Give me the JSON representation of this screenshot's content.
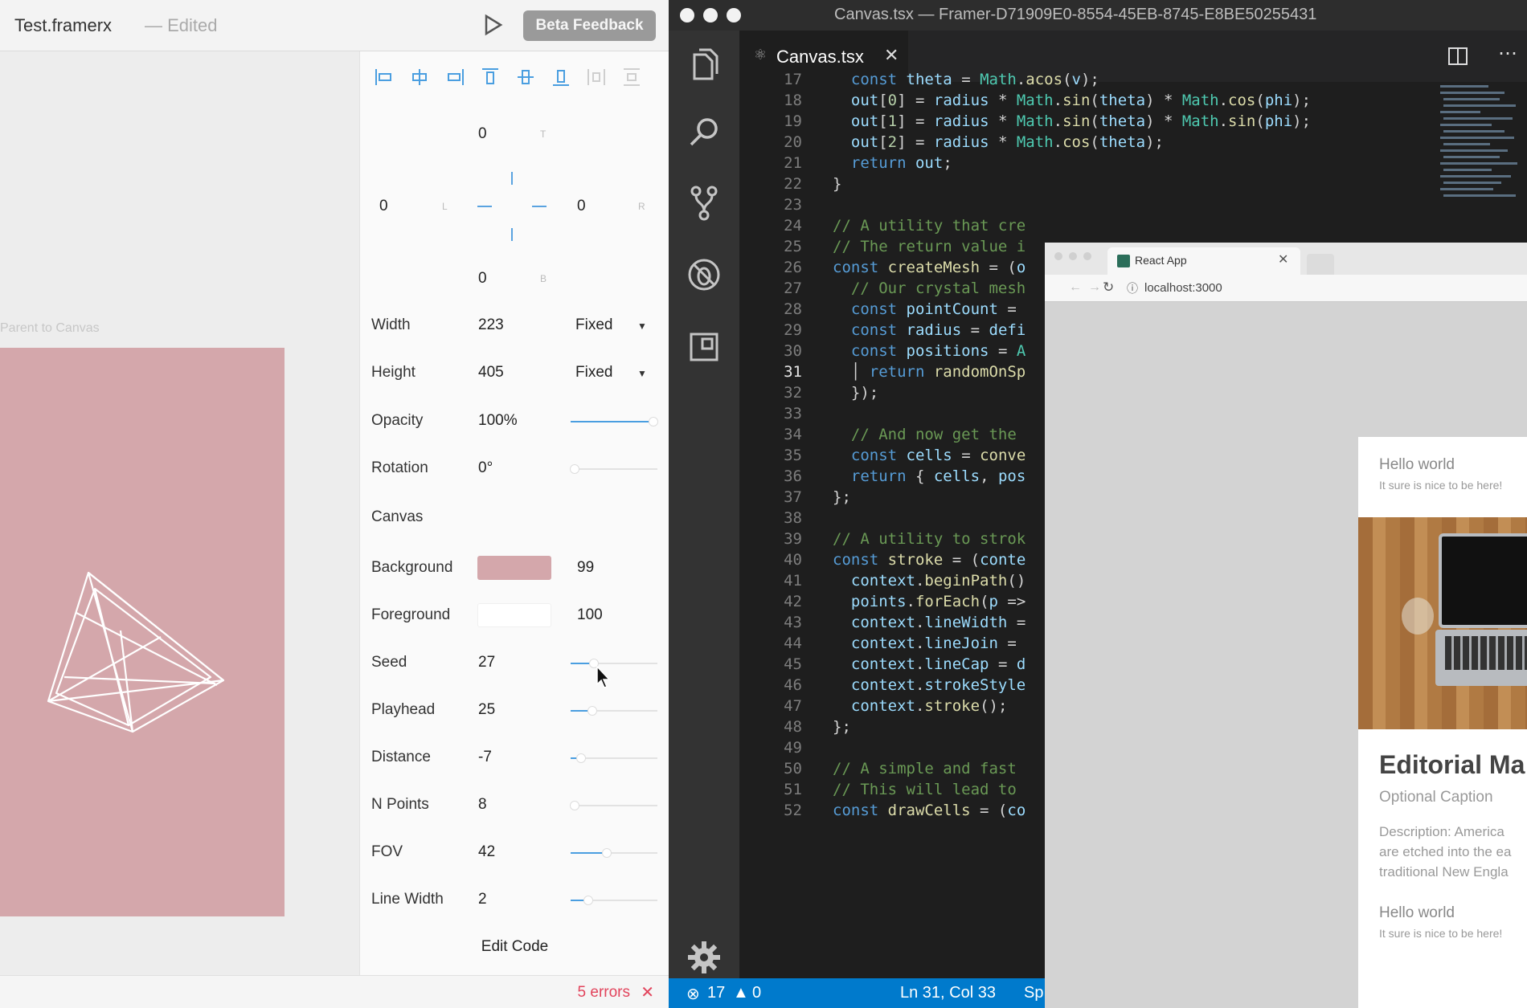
{
  "framer": {
    "title": "Test.framerx",
    "edited": "— Edited",
    "beta_button": "Beta Feedback",
    "frame_label": "Parent to Canvas",
    "pins": {
      "top": "0",
      "left": "0",
      "right": "0",
      "bottom": "0",
      "top_lbl": "T",
      "left_lbl": "L",
      "right_lbl": "R",
      "bottom_lbl": "B"
    },
    "width": {
      "label": "Width",
      "value": "223",
      "mode": "Fixed"
    },
    "height": {
      "label": "Height",
      "value": "405",
      "mode": "Fixed"
    },
    "opacity": {
      "label": "Opacity",
      "value": "100%",
      "fraction": 0.95
    },
    "rotation": {
      "label": "Rotation",
      "value": "0°",
      "fraction": 0.05
    },
    "section": "Canvas",
    "background": {
      "label": "Background",
      "value": "99",
      "color": "#d4a7ab"
    },
    "foreground": {
      "label": "Foreground",
      "value": "100",
      "color": "#ffffff"
    },
    "seed": {
      "label": "Seed",
      "value": "27",
      "fraction": 0.27
    },
    "playhead": {
      "label": "Playhead",
      "value": "25",
      "fraction": 0.25
    },
    "distance": {
      "label": "Distance",
      "value": "-7",
      "fraction": 0.12
    },
    "npoints": {
      "label": "N Points",
      "value": "8",
      "fraction": 0.05
    },
    "fov": {
      "label": "FOV",
      "value": "42",
      "fraction": 0.42
    },
    "linewidth": {
      "label": "Line Width",
      "value": "2",
      "fraction": 0.2
    },
    "edit_code": "Edit Code",
    "errors": "5 errors"
  },
  "vscode": {
    "title": "Canvas.tsx — Framer-D71909E0-8554-45EB-8745-E8BE50255431",
    "tab": "Canvas.tsx",
    "status_errors": "17",
    "status_warnings": "0",
    "cursor_pos": "Ln 31, Col 33",
    "status_sp": "Sp",
    "line_numbers": [
      "17",
      "18",
      "19",
      "20",
      "21",
      "22",
      "23",
      "24",
      "25",
      "26",
      "27",
      "28",
      "29",
      "30",
      "31",
      "32",
      "33",
      "34",
      "35",
      "36",
      "37",
      "38",
      "39",
      "40",
      "41",
      "42",
      "43",
      "44",
      "45",
      "46",
      "47",
      "48",
      "49",
      "50",
      "51",
      "52"
    ]
  },
  "browser": {
    "tab_title": "React App",
    "url": "localhost:3000",
    "hello1": "Hello world",
    "sub1": "It sure is nice to be here!",
    "heading": "Editorial Ma",
    "caption": "Optional Caption",
    "desc1": "Description: America",
    "desc2": "are etched into the ea",
    "desc3": "traditional New Engla",
    "hello2": "Hello world",
    "sub2": "It sure is nice to be here!"
  }
}
